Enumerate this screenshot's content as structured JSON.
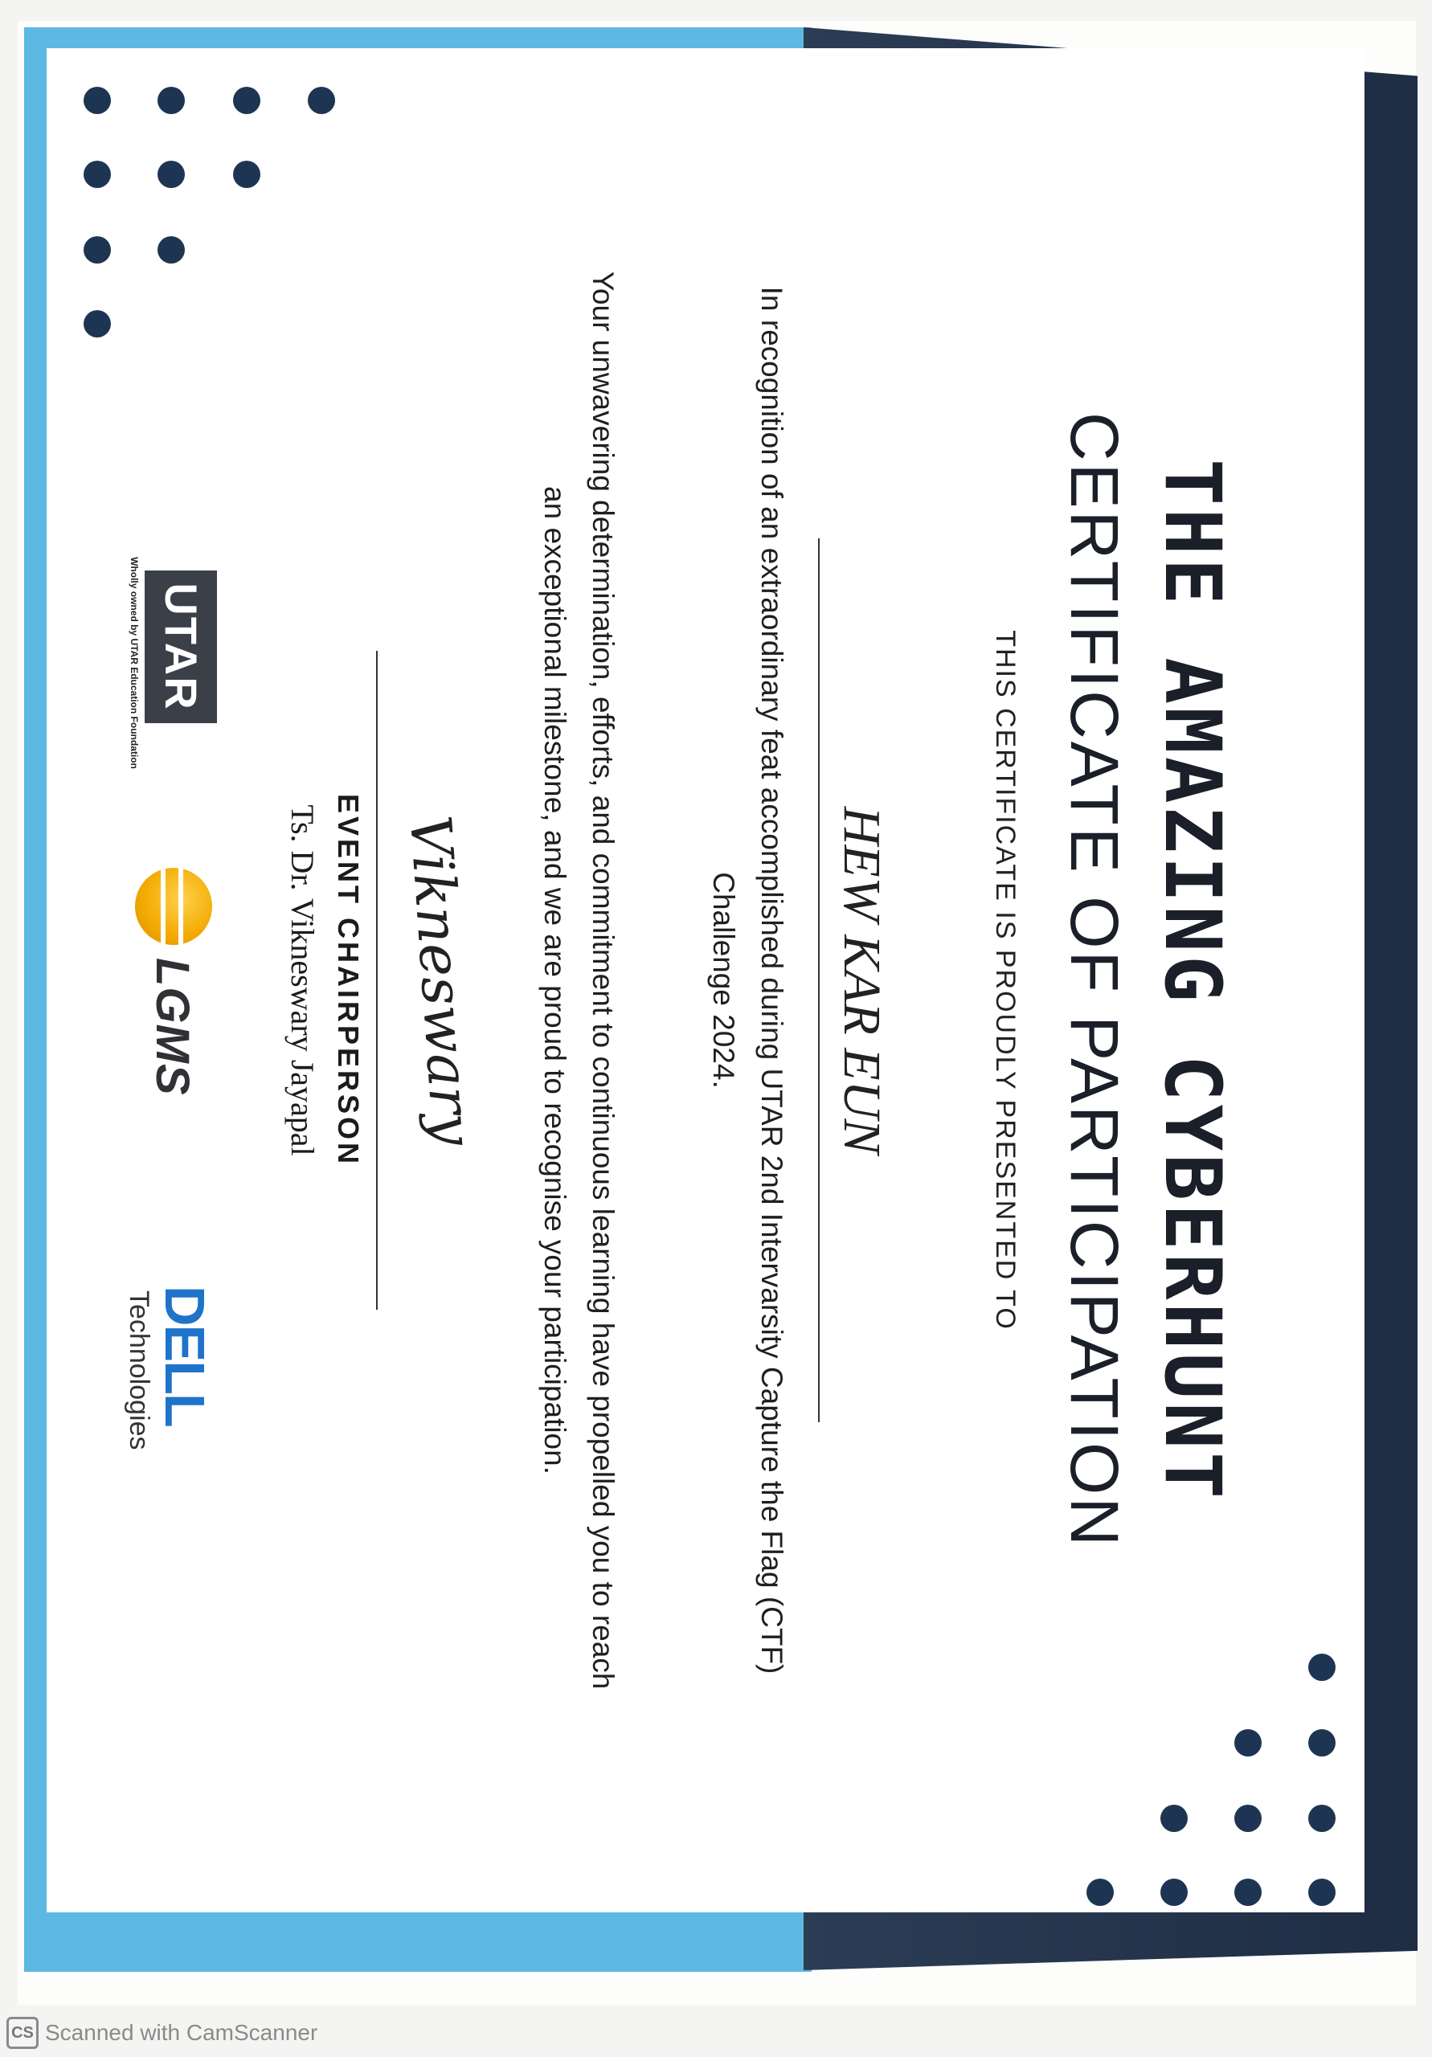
{
  "certificate": {
    "title_line1": "THE AMAZING CYBERHUNT",
    "title_line2": "CERTIFICATE OF PARTICIPATION",
    "presented_to": "THIS CERTIFICATE IS PROUDLY PRESENTED TO",
    "recipient": "HEW KAR EUN",
    "paragraph1": "In recognition of an extraordinary feat accomplished during UTAR 2nd Intervarsity Capture the Flag (CTF) Challenge 2024.",
    "paragraph2": "Your unwavering determination, efforts, and commitment to continuous learning have propelled you to reach an exceptional milestone, and we are proud to recognise your participation."
  },
  "signatory": {
    "signature": "Vikneswary",
    "role": "EVENT CHAIRPERSON",
    "name": "Ts. Dr. Vikneswary Jayapal"
  },
  "logos": {
    "utar": "UTAR",
    "utar_caption": "Wholly owned by UTAR Education Foundation",
    "lgms": "LGMS",
    "dell": "DELL",
    "dell_sub": "Technologies"
  },
  "scanner": {
    "icon": "CS",
    "label": "Scanned with CamScanner"
  },
  "colors": {
    "frame_light_blue": "#5db8e2",
    "frame_navy": "#1e2d44",
    "dots": "#1d3553",
    "text": "#1b1f29",
    "dell_blue": "#1f74c9",
    "lgms_orange": "#f2a900"
  }
}
